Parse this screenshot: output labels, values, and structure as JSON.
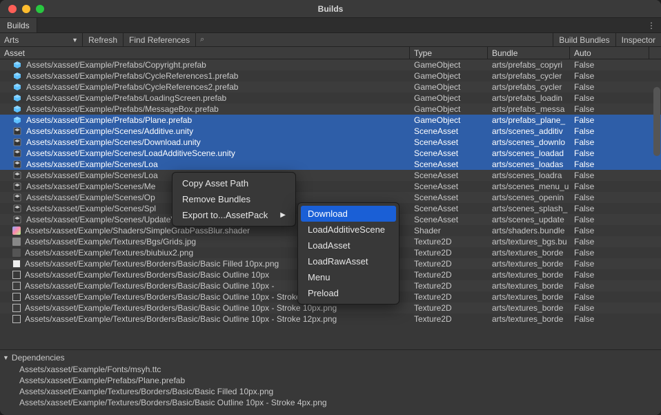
{
  "window": {
    "title": "Builds"
  },
  "tabs": [
    {
      "label": "Builds"
    }
  ],
  "toolbar": {
    "dropdown": "Arts",
    "refresh": "Refresh",
    "find_refs": "Find References",
    "search_placeholder": "",
    "build_bundles": "Build Bundles",
    "inspector": "Inspector"
  },
  "columns": {
    "asset": "Asset",
    "type": "Type",
    "bundle": "Bundle",
    "auto": "Auto"
  },
  "rows": [
    {
      "icon": "prefab",
      "asset": "Assets/xasset/Example/Prefabs/Copyright.prefab",
      "type": "GameObject",
      "bundle": "arts/prefabs_copyri",
      "auto": "False",
      "sel": false
    },
    {
      "icon": "prefab",
      "asset": "Assets/xasset/Example/Prefabs/CycleReferences1.prefab",
      "type": "GameObject",
      "bundle": "arts/prefabs_cycler",
      "auto": "False",
      "sel": false
    },
    {
      "icon": "prefab",
      "asset": "Assets/xasset/Example/Prefabs/CycleReferences2.prefab",
      "type": "GameObject",
      "bundle": "arts/prefabs_cycler",
      "auto": "False",
      "sel": false
    },
    {
      "icon": "prefab",
      "asset": "Assets/xasset/Example/Prefabs/LoadingScreen.prefab",
      "type": "GameObject",
      "bundle": "arts/prefabs_loadin",
      "auto": "False",
      "sel": false
    },
    {
      "icon": "prefab",
      "asset": "Assets/xasset/Example/Prefabs/MessageBox.prefab",
      "type": "GameObject",
      "bundle": "arts/prefabs_messa",
      "auto": "False",
      "sel": false
    },
    {
      "icon": "prefab",
      "asset": "Assets/xasset/Example/Prefabs/Plane.prefab",
      "type": "GameObject",
      "bundle": "arts/prefabs_plane_",
      "auto": "False",
      "sel": true
    },
    {
      "icon": "scene",
      "asset": "Assets/xasset/Example/Scenes/Additive.unity",
      "type": "SceneAsset",
      "bundle": "arts/scenes_additiv",
      "auto": "False",
      "sel": true
    },
    {
      "icon": "scene",
      "asset": "Assets/xasset/Example/Scenes/Download.unity",
      "type": "SceneAsset",
      "bundle": "arts/scenes_downlo",
      "auto": "False",
      "sel": true
    },
    {
      "icon": "scene",
      "asset": "Assets/xasset/Example/Scenes/LoadAdditiveScene.unity",
      "type": "SceneAsset",
      "bundle": "arts/scenes_loadad",
      "auto": "False",
      "sel": true
    },
    {
      "icon": "scene",
      "asset": "Assets/xasset/Example/Scenes/Loa",
      "type": "SceneAsset",
      "bundle": "arts/scenes_loadas",
      "auto": "False",
      "sel": true
    },
    {
      "icon": "scene",
      "asset": "Assets/xasset/Example/Scenes/Loa",
      "type": "SceneAsset",
      "bundle": "arts/scenes_loadra",
      "auto": "False",
      "sel": false
    },
    {
      "icon": "scene",
      "asset": "Assets/xasset/Example/Scenes/Me",
      "type": "SceneAsset",
      "bundle": "arts/scenes_menu_u",
      "auto": "False",
      "sel": false
    },
    {
      "icon": "scene",
      "asset": "Assets/xasset/Example/Scenes/Op",
      "type": "SceneAsset",
      "bundle": "arts/scenes_openin",
      "auto": "False",
      "sel": false
    },
    {
      "icon": "scene",
      "asset": "Assets/xasset/Example/Scenes/Spl",
      "type": "SceneAsset",
      "bundle": "arts/scenes_splash_",
      "auto": "False",
      "sel": false
    },
    {
      "icon": "scene",
      "asset": "Assets/xasset/Example/Scenes/UpdateVersions.unity",
      "type": "SceneAsset",
      "bundle": "arts/scenes_update",
      "auto": "False",
      "sel": false
    },
    {
      "icon": "shader",
      "asset": "Assets/xasset/Example/Shaders/SimpleGrabPassBlur.shader",
      "type": "Shader",
      "bundle": "arts/shaders.bundle",
      "auto": "False",
      "sel": false
    },
    {
      "icon": "tex",
      "asset": "Assets/xasset/Example/Textures/Bgs/Grids.jpg",
      "type": "Texture2D",
      "bundle": "arts/textures_bgs.bu",
      "auto": "False",
      "sel": false
    },
    {
      "icon": "generic",
      "asset": "Assets/xasset/Example/Textures/biubiux2.png",
      "type": "Texture2D",
      "bundle": "arts/textures_borde",
      "auto": "False",
      "sel": false
    },
    {
      "icon": "texw",
      "asset": "Assets/xasset/Example/Textures/Borders/Basic/Basic Filled 10px.png",
      "type": "Texture2D",
      "bundle": "arts/textures_borde",
      "auto": "False",
      "sel": false
    },
    {
      "icon": "texo",
      "asset": "Assets/xasset/Example/Textures/Borders/Basic/Basic Outline 10px",
      "type": "Texture2D",
      "bundle": "arts/textures_borde",
      "auto": "False",
      "sel": false
    },
    {
      "icon": "texo",
      "asset": "Assets/xasset/Example/Textures/Borders/Basic/Basic Outline 10px - ",
      "type": "Texture2D",
      "bundle": "arts/textures_borde",
      "auto": "False",
      "sel": false
    },
    {
      "icon": "texo",
      "asset": "Assets/xasset/Example/Textures/Borders/Basic/Basic Outline 10px - Stroke 8px.png",
      "type": "Texture2D",
      "bundle": "arts/textures_borde",
      "auto": "False",
      "sel": false
    },
    {
      "icon": "texo",
      "asset": "Assets/xasset/Example/Textures/Borders/Basic/Basic Outline 10px - Stroke 10px.png",
      "type": "Texture2D",
      "bundle": "arts/textures_borde",
      "auto": "False",
      "sel": false
    },
    {
      "icon": "texo",
      "asset": "Assets/xasset/Example/Textures/Borders/Basic/Basic Outline 10px - Stroke 12px.png",
      "type": "Texture2D",
      "bundle": "arts/textures_borde",
      "auto": "False",
      "sel": false
    }
  ],
  "deps_header": "Dependencies",
  "deps": [
    "Assets/xasset/Example/Fonts/msyh.ttc",
    "Assets/xasset/Example/Prefabs/Plane.prefab",
    "Assets/xasset/Example/Textures/Borders/Basic/Basic Filled 10px.png",
    "Assets/xasset/Example/Textures/Borders/Basic/Basic Outline 10px - Stroke 4px.png"
  ],
  "context_menu": {
    "items": [
      {
        "label": "Copy Asset Path"
      },
      {
        "label": "Remove Bundles"
      },
      {
        "label": "Export to...AssetPack",
        "submenu": true,
        "selected": true
      }
    ],
    "submenu": [
      {
        "label": "Download",
        "selected": true
      },
      {
        "label": "LoadAdditiveScene"
      },
      {
        "label": "LoadAsset"
      },
      {
        "label": "LoadRawAsset"
      },
      {
        "label": "Menu"
      },
      {
        "label": "Preload"
      }
    ]
  }
}
